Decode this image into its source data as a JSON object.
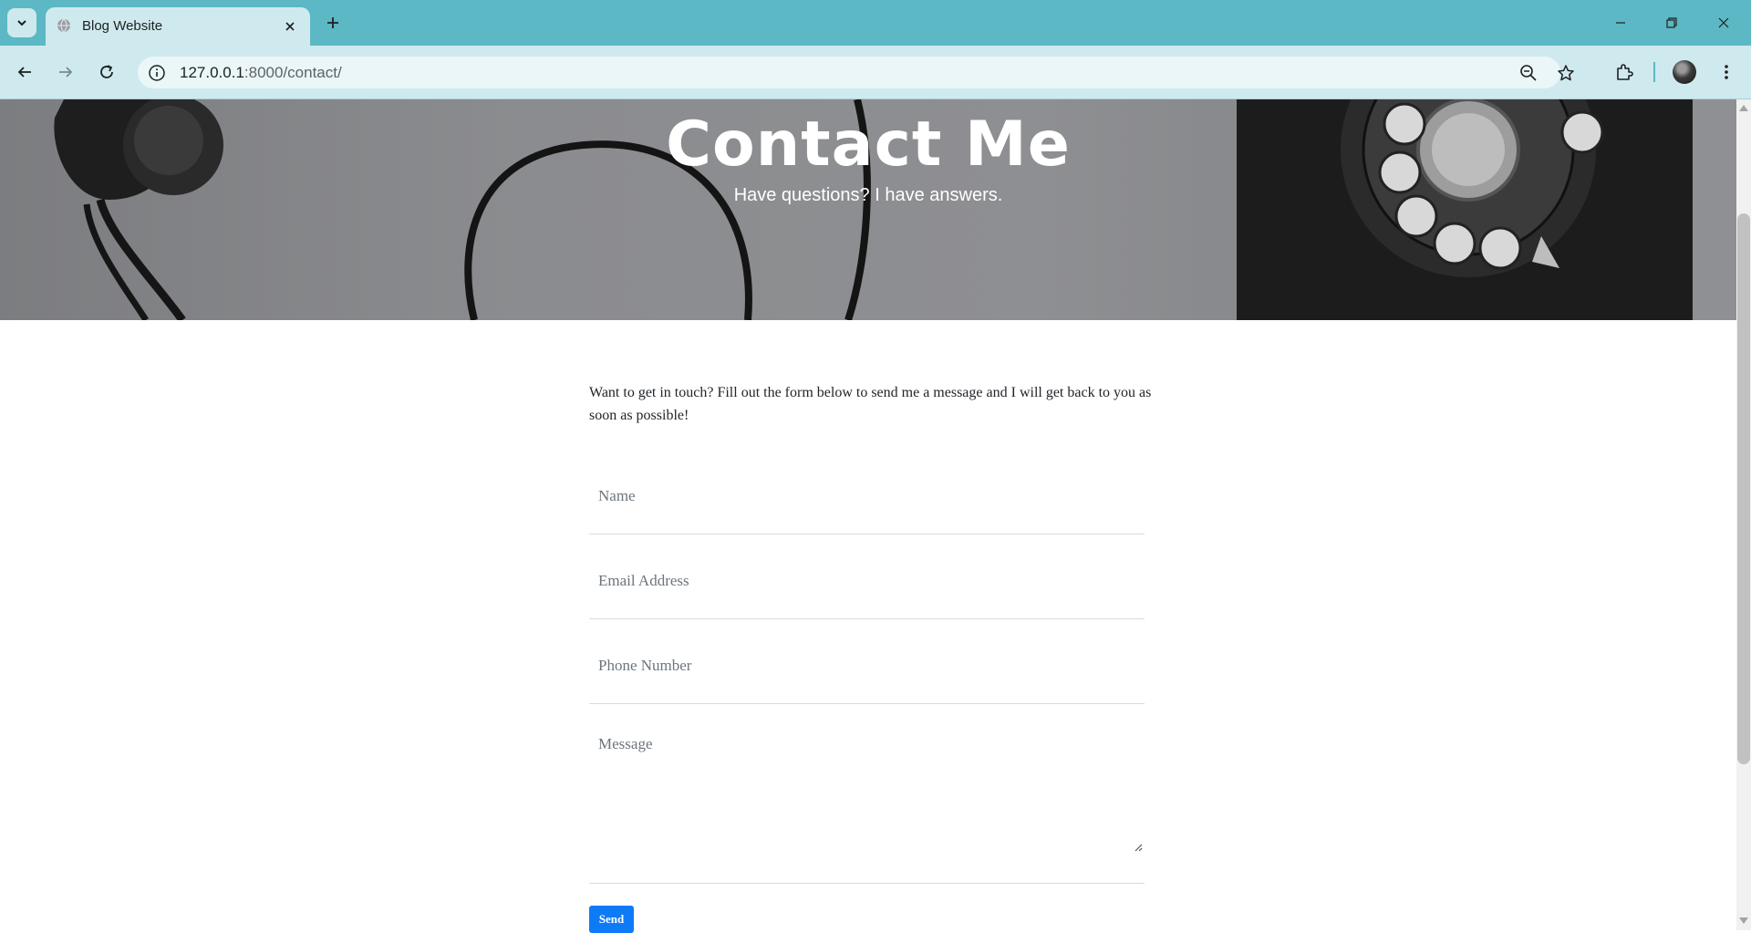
{
  "browser": {
    "tab_title": "Blog Website",
    "url_host": "127.0.0.1",
    "url_path": ":8000/contact/",
    "accent_color": "#5bb8c4"
  },
  "hero": {
    "title": "Contact Me",
    "subtitle": "Have questions? I have answers."
  },
  "intro": {
    "text": "Want to get in touch? Fill out the form below to send me a message and I will get back to you as soon as possible!"
  },
  "form": {
    "name_placeholder": "Name",
    "email_placeholder": "Email Address",
    "phone_placeholder": "Phone Number",
    "message_placeholder": "Message",
    "send_label": "Send",
    "send_color": "#0d7bf6"
  }
}
